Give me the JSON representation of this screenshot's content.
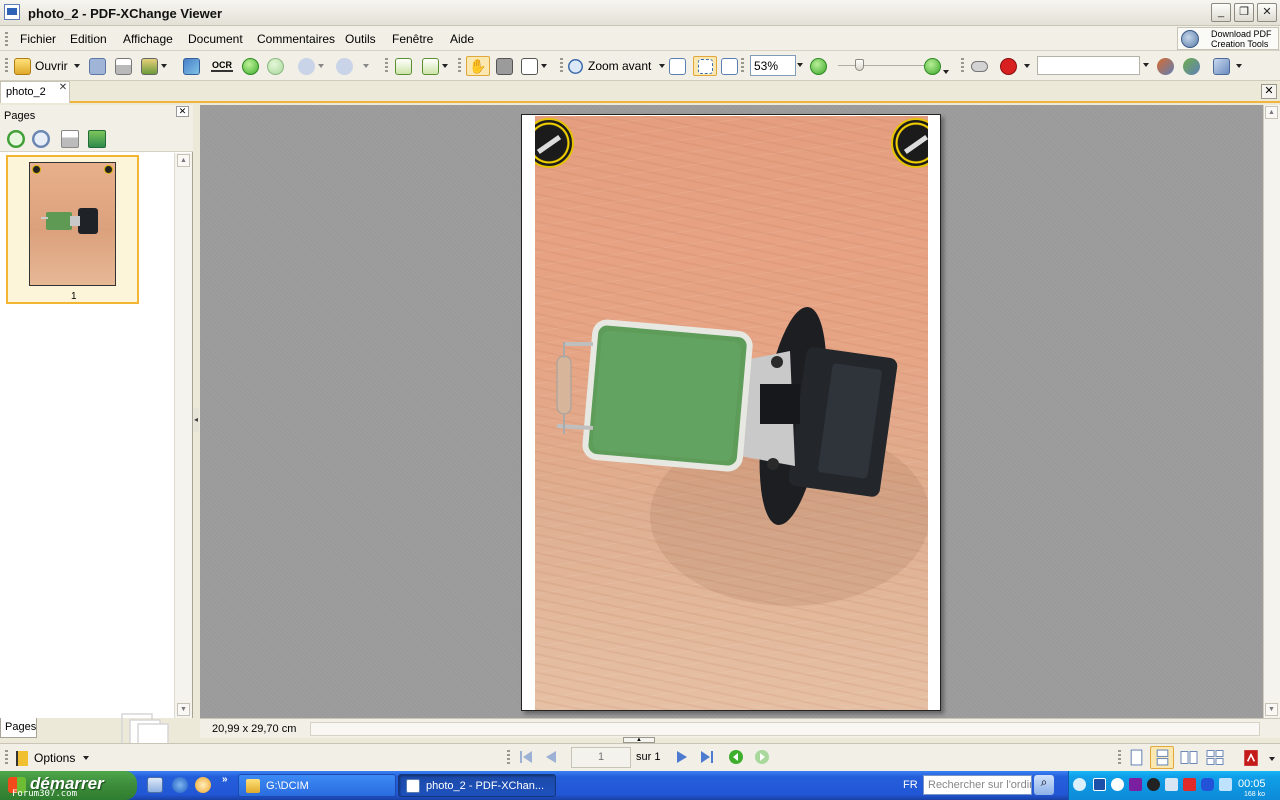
{
  "window": {
    "title": "photo_2 - PDF-XChange Viewer",
    "min_label": "_",
    "max_label": "❐",
    "close_label": "✕"
  },
  "menubar": {
    "items": [
      "Fichier",
      "Edition",
      "Affichage",
      "Document",
      "Commentaires",
      "Outils",
      "Fenêtre",
      "Aide"
    ],
    "promo_line1": "Download PDF",
    "promo_line2": "Creation Tools"
  },
  "toolbar": {
    "open_label": "Ouvrir",
    "ocr_label": "OCR",
    "zoom_in_label": "Zoom avant",
    "zoom_value": "53%",
    "search_value": ""
  },
  "tabs": {
    "doc_tab": "photo_2",
    "close_glyph": "✕"
  },
  "pages_panel": {
    "title": "Pages",
    "close_glyph": "✕",
    "thumbnail_label": "1",
    "bottom_tab": "Pages"
  },
  "status": {
    "page_size": "20,99 x 29,70 cm"
  },
  "bottombar": {
    "options_label": "Options",
    "page_current": "1",
    "page_of": "sur 1"
  },
  "taskbar": {
    "start_label": "démarrer",
    "watermark": "Forum307.com",
    "tasks": [
      "G:\\DCIM",
      "photo_2 - PDF-XChan..."
    ],
    "lang": "FR",
    "search_placeholder": "Rechercher sur l'ordin",
    "clock": "00:05",
    "net_rate": "168 ko"
  },
  "colors": {
    "tab_accent": "#f1b43c",
    "viewer_bg": "#9a9a9a",
    "taskbar_blue": "#245edb",
    "start_green": "#3c8b3a"
  }
}
